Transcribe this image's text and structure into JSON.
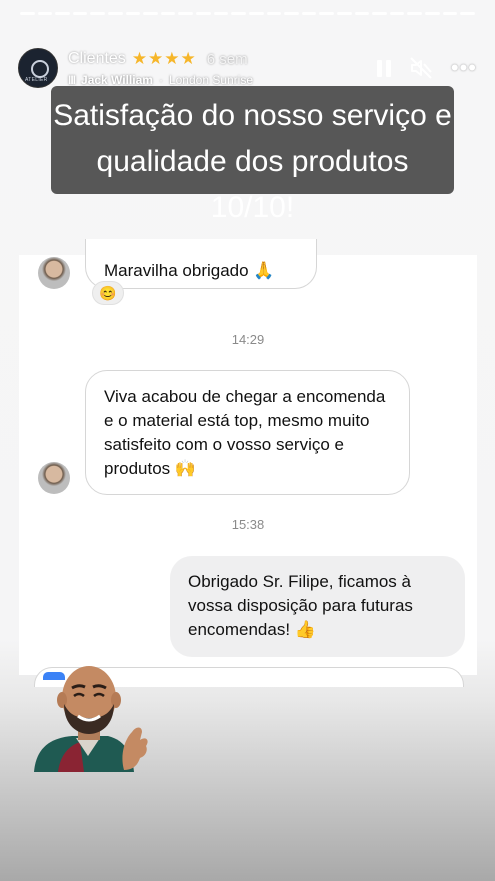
{
  "story": {
    "account_title": "Clientes",
    "rating_stars": "★★★★",
    "age": "6 sem",
    "music_bars": "III",
    "music_artist": "Jack William",
    "music_song": "London Sunrise",
    "avatar_text": "ATELIER",
    "icons": [
      "pause-icon",
      "mute-icon",
      "more-icon"
    ],
    "more_glyph": "•••",
    "caption": "Satisfação do nosso serviço e qualidade dos produtos 10/10!"
  },
  "chat": {
    "messages": [
      {
        "direction": "incoming",
        "text": "Maravilha obrigado 🙏",
        "reaction": "😊"
      },
      {
        "timestamp": "14:29"
      },
      {
        "direction": "incoming",
        "text": "Viva acabou de chegar a encomenda e o material está top, mesmo muito satisfeito com o vosso serviço e produtos 🙌"
      },
      {
        "timestamp": "15:38"
      },
      {
        "direction": "outgoing",
        "text": "Obrigado Sr. Filipe, ficamos à vossa disposição para futuras encomendas! 👍"
      }
    ]
  },
  "colors": {
    "caption_bg": "#575757",
    "star": "#f6b62a",
    "outgoing_bubble": "#efeff0",
    "incoming_border": "#d6d6d6"
  }
}
